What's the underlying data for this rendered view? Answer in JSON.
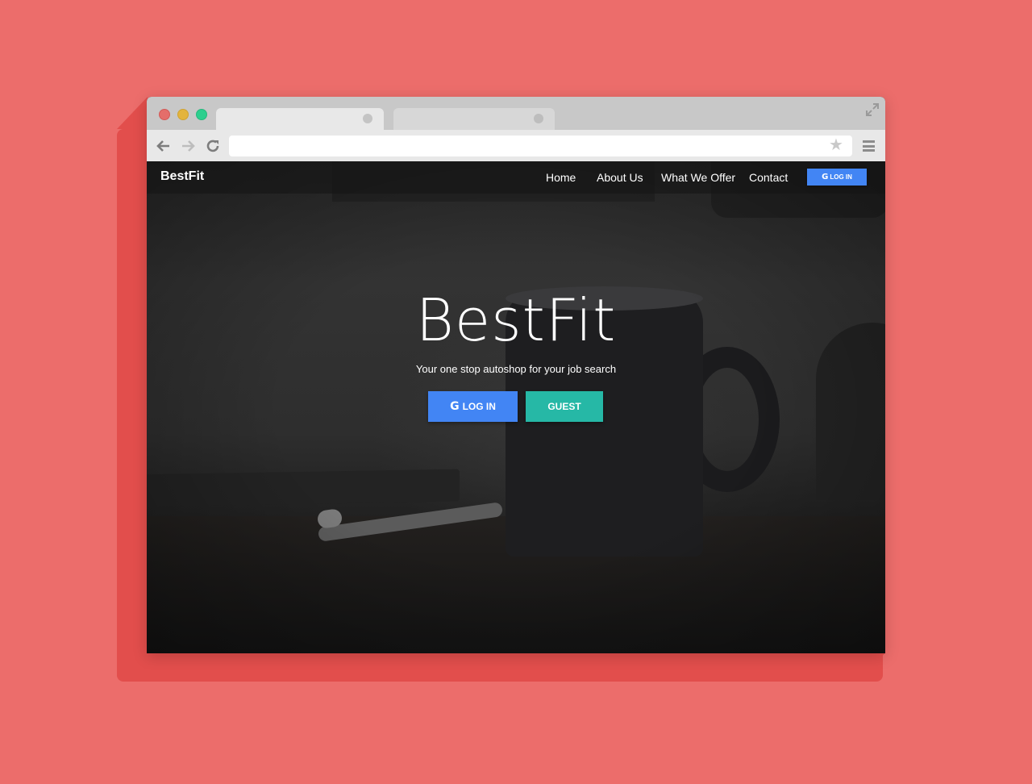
{
  "browser": {
    "address_value": ""
  },
  "site": {
    "brand": "BestFit",
    "nav": {
      "home": "Home",
      "about": "About Us",
      "offer": "What We Offer",
      "contact": "Contact",
      "login": "LOG IN"
    },
    "hero": {
      "title": "BestFit",
      "subtitle": "Your one stop autoshop for your job search",
      "login_button": "LOG IN",
      "guest_button": "GUEST"
    }
  },
  "icons": {
    "google": "G"
  },
  "colors": {
    "background": "#ec6d6b",
    "google_blue": "#4285f4",
    "guest_teal": "#26b8a6"
  }
}
